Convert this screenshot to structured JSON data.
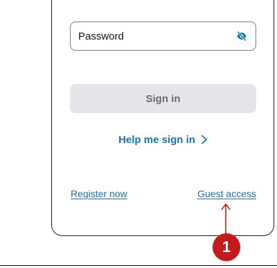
{
  "form": {
    "password_label": "Password",
    "signin_label": "Sign in",
    "help_label": "Help me sign in",
    "register_label": "Register now",
    "guest_label": "Guest access"
  },
  "callout": {
    "number": "1"
  },
  "icons": {
    "password_toggle": "eye-slash-icon",
    "help_chevron": "chevron-right-icon",
    "callout_arrow": "arrow-up-icon"
  },
  "colors": {
    "link": "#1672b0",
    "button_disabled_bg": "#e6e6ea",
    "button_disabled_text": "#6b6b6f",
    "callout": "#c41a1a"
  }
}
